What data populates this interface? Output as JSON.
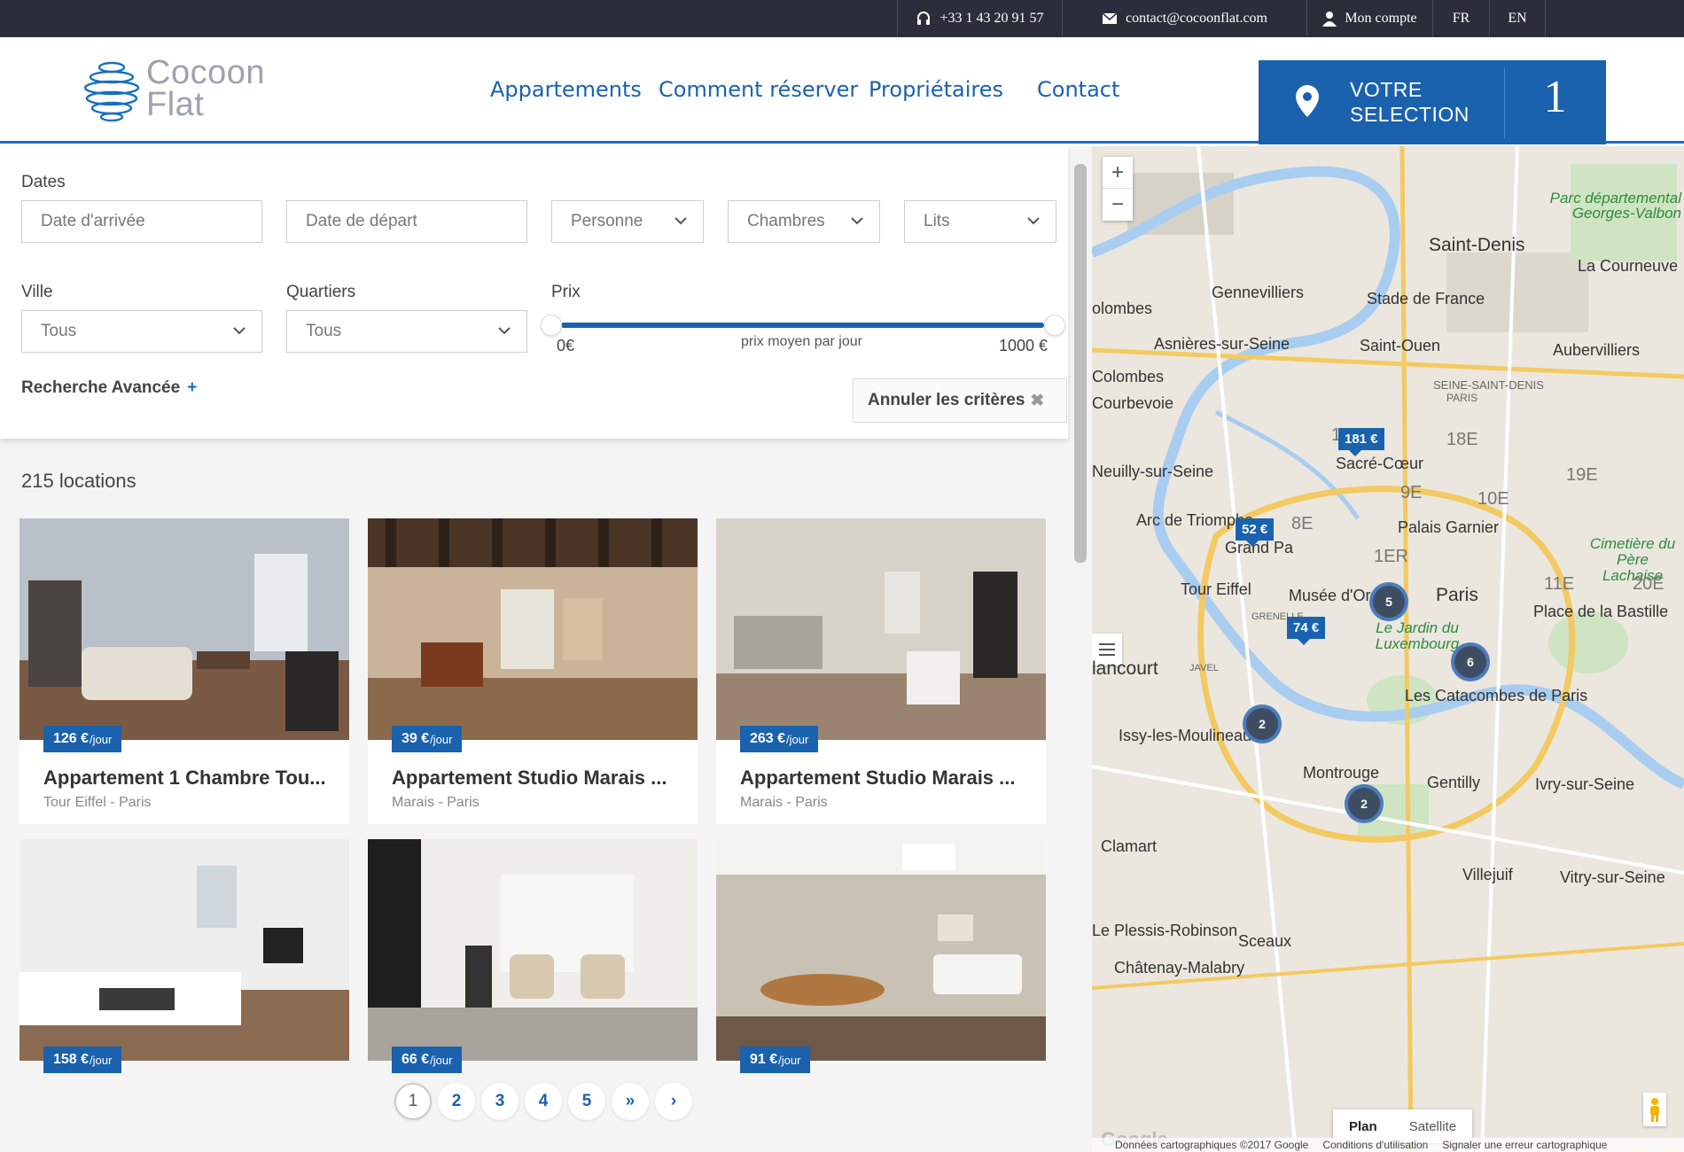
{
  "topbar": {
    "phone": "+33 1 43 20 91 57",
    "email": "contact@cocoonflat.com",
    "account": "Mon compte",
    "lang_fr": "FR",
    "lang_en": "EN"
  },
  "header": {
    "logo_line1": "Cocoon",
    "logo_line2": "Flat",
    "nav": [
      "Appartements",
      "Comment réserver",
      "Propriétaires",
      "Contact"
    ],
    "selection_line1": "VOTRE",
    "selection_line2": "SELECTION",
    "selection_count": "1"
  },
  "filters": {
    "dates_label": "Dates",
    "arrival_placeholder": "Date d'arrivée",
    "departure_placeholder": "Date de départ",
    "persons": "Personne",
    "rooms": "Chambres",
    "beds": "Lits",
    "city_label": "Ville",
    "city_value": "Tous",
    "district_label": "Quartiers",
    "district_value": "Tous",
    "price_label": "Prix",
    "price_min": "0€",
    "price_caption": "prix moyen par jour",
    "price_max": "1000 €",
    "advanced": "Recherche Avancée",
    "advanced_plus": "+",
    "reset": "Annuler les critères",
    "reset_x": "✖"
  },
  "results": {
    "count": "215 locations",
    "listings": [
      {
        "price": "126 €",
        "unit": "/jour",
        "title": "Appartement 1 Chambre Tou...",
        "location": "Tour Eiffel - Paris"
      },
      {
        "price": "39 €",
        "unit": "/jour",
        "title": "Appartement Studio Marais ...",
        "location": "Marais - Paris"
      },
      {
        "price": "263 €",
        "unit": "/jour",
        "title": "Appartement Studio Marais ...",
        "location": "Marais - Paris"
      },
      {
        "price": "158 €",
        "unit": "/jour",
        "title": "",
        "location": ""
      },
      {
        "price": "66 €",
        "unit": "/jour",
        "title": "",
        "location": ""
      },
      {
        "price": "91 €",
        "unit": "/jour",
        "title": "",
        "location": ""
      }
    ]
  },
  "pagination": {
    "pages": [
      "1",
      "2",
      "3",
      "4",
      "5"
    ],
    "last": "»",
    "next": "›",
    "current": "1"
  },
  "map": {
    "zoom_in": "+",
    "zoom_out": "−",
    "labels": {
      "saint_denis": "Saint-Denis",
      "la_courneuve": "La Courneuve",
      "gennevilliers": "Gennevilliers",
      "stade_de_france": "Stade de France",
      "colombes_partial": "olombes",
      "asnieres": "Asnières-sur-Seine",
      "saint_ouen": "Saint-Ouen",
      "aubervilliers": "Aubervilliers",
      "colombes": "Colombes",
      "seine_saint_denis": "SEINE-SAINT-DENIS",
      "paris_small": "PARIS",
      "courbevoie": "Courbevoie",
      "neuilly": "Neuilly-sur-Seine",
      "d17e": "17E",
      "d18e": "18E",
      "sacre_coeur": "Sacré-Cœur",
      "d19e": "19E",
      "d9e": "9E",
      "d10e": "10E",
      "arc": "Arc de Triomphe",
      "d8e": "8E",
      "palais_garnier": "Palais Garnier",
      "grand_palais": "Grand Pa",
      "d1er": "1ER",
      "cimetiere": "Cimetière du Père Lachaise",
      "tour_eiffel": "Tour Eiffel",
      "musee_orsay": "Musée d'Orsay",
      "paris": "Paris",
      "d11e": "11E",
      "d20e": "20E",
      "bastille": "Place de la Bastille",
      "jardin_lux": "Le Jardin du Luxembourg",
      "grenelle": "GRENELLE",
      "javel": "JAVEL",
      "lancourt": "lancourt",
      "catacombes": "Les Catacombes de Paris",
      "issy": "Issy-les-Moulineaux",
      "montrouge": "Montrouge",
      "gentilly": "Gentilly",
      "ivry": "Ivry-sur-Seine",
      "clamart": "Clamart",
      "villejuif": "Villejuif",
      "vitry": "Vitry-sur-Seine",
      "plessis": "Le Plessis-Robinson",
      "sceaux": "Sceaux",
      "chatenay": "Châtenay-Malabry",
      "parc_georges": "Parc départemental Georges-Valbon"
    },
    "pins": [
      "181 €",
      "52 €",
      "74 €"
    ],
    "clusters": [
      "5",
      "6",
      "2",
      "2"
    ],
    "plan": "Plan",
    "satellite": "Satellite",
    "attribution": "Données cartographiques ©2017 Google",
    "terms": "Conditions d'utilisation",
    "report": "Signaler une erreur cartographique",
    "brand": "Google"
  },
  "colors": {
    "brand_blue": "#1a62ad",
    "topbar_bg": "#2a2d3a",
    "cluster_bg": "#3f4d63"
  }
}
